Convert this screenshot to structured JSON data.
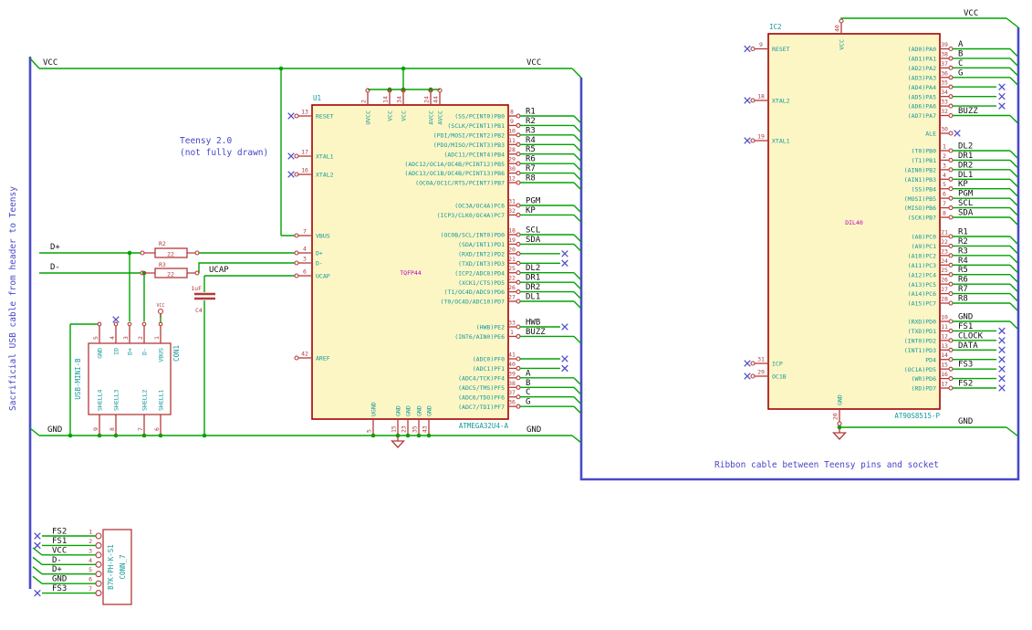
{
  "notes": {
    "sacrificial": "Sacrificial USB cable from header to Teensy",
    "teensy1": "Teensy 2.0",
    "teensy2": "(not fully drawn)",
    "ribbon": "Ribbon cable between Teensy pins and socket"
  },
  "labels": {
    "vcc": "VCC",
    "gnd": "GND",
    "dplus": "D+",
    "dminus": "D-",
    "ucap": "UCAP"
  },
  "u1": {
    "ref": "U1",
    "value": "ATMEGA32U4-A",
    "package": "TQFP44",
    "left_pins": [
      {
        "num": "13",
        "name": "RESET"
      },
      {
        "num": "17",
        "name": "XTAL1"
      },
      {
        "num": "16",
        "name": "XTAL2"
      },
      {
        "num": "7",
        "name": "VBUS"
      },
      {
        "num": "4",
        "name": "D+"
      },
      {
        "num": "3",
        "name": "D-"
      },
      {
        "num": "6",
        "name": "UCAP"
      },
      {
        "num": "42",
        "name": "AREF"
      }
    ],
    "top_pins": [
      {
        "num": "2",
        "name": "UVCC"
      },
      {
        "num": "14",
        "name": "VCC"
      },
      {
        "num": "34",
        "name": "VCC"
      },
      {
        "num": "24",
        "name": "AVCC"
      },
      {
        "num": "44",
        "name": "AVCC"
      }
    ],
    "bottom_pins": [
      {
        "num": "5",
        "name": "UGND"
      },
      {
        "num": "15",
        "name": "GND"
      },
      {
        "num": "23",
        "name": "GND"
      },
      {
        "num": "35",
        "name": "GND"
      },
      {
        "num": "43",
        "name": "GND"
      }
    ],
    "right_g1": [
      {
        "num": "8",
        "name": "(SS/PCINT0)PB0",
        "label": "R1",
        "term": "bus"
      },
      {
        "num": "9",
        "name": "(SCLK/PCINT1)PB1",
        "label": "R2",
        "term": "bus"
      },
      {
        "num": "10",
        "name": "(PDI/MOSI/PCINT2)PB2",
        "label": "R3",
        "term": "bus"
      },
      {
        "num": "11",
        "name": "(PDO/MISO/PCINT3)PB3",
        "label": "R4",
        "term": "bus"
      },
      {
        "num": "28",
        "name": "(ADC11/PCINT4)PB4",
        "label": "R5",
        "term": "bus"
      },
      {
        "num": "29",
        "name": "(ADC12/OC1A/OC4B/PCINT12)PB5",
        "label": "R6",
        "term": "bus"
      },
      {
        "num": "30",
        "name": "(ADC13/OC1B/OC4B/PCINT13)PB6",
        "label": "R7",
        "term": "bus"
      },
      {
        "num": "12",
        "name": "(OC0A/OC1C/RTS/PCINT7)PB7",
        "label": "R8",
        "term": "bus"
      }
    ],
    "right_g2": [
      {
        "num": "31",
        "name": "(OC3A/OC4A)PC6",
        "label": "PGM",
        "term": "bus"
      },
      {
        "num": "32",
        "name": "(ICP3/CLK0/OC4A)PC7",
        "label": "KP",
        "term": "bus"
      }
    ],
    "right_g3": [
      {
        "num": "18",
        "name": "(OC0B/SCL/INT0)PD0",
        "label": "SCL",
        "term": "bus"
      },
      {
        "num": "19",
        "name": "(SDA/INT1)PD1",
        "label": "SDA",
        "term": "bus"
      },
      {
        "num": "20",
        "name": "(RXD/INT2)PD2",
        "label": "",
        "term": "x"
      },
      {
        "num": "21",
        "name": "(TXD/INT3)PD3",
        "label": "",
        "term": "x"
      },
      {
        "num": "25",
        "name": "(ICP2/ADC8)PD4",
        "label": "DL2",
        "term": "bus"
      },
      {
        "num": "22",
        "name": "(XCK1/CTS)PD5",
        "label": "DR1",
        "term": "bus"
      },
      {
        "num": "26",
        "name": "(T1/OC4D/ADC9)PD6",
        "label": "DR2",
        "term": "bus"
      },
      {
        "num": "27",
        "name": "(T0/OC4D/ADC10)PD7",
        "label": "DL1",
        "term": "bus"
      }
    ],
    "right_g4": [
      {
        "num": "33",
        "name": "(HWB)PE2",
        "label": "HWB",
        "term": "x"
      },
      {
        "num": "1",
        "name": "(INT6/AIN0)PE6",
        "label": "BUZZ",
        "term": "bus"
      }
    ],
    "right_g5": [
      {
        "num": "41",
        "name": "(ADC0)PF0",
        "label": "",
        "term": "x"
      },
      {
        "num": "40",
        "name": "(ADC1)PF1",
        "label": "",
        "term": "x"
      },
      {
        "num": "39",
        "name": "(ADC4/TCK)PF4",
        "label": "A",
        "term": "bus"
      },
      {
        "num": "38",
        "name": "(ADC5/TMS)PF5",
        "label": "B",
        "term": "bus"
      },
      {
        "num": "37",
        "name": "(ADC6/TDO)PF6",
        "label": "C",
        "term": "bus"
      },
      {
        "num": "36",
        "name": "(ADC7/TDI)PF7",
        "label": "G",
        "term": "bus"
      }
    ]
  },
  "ic2": {
    "ref": "IC2",
    "value": "AT90S8515-P",
    "package": "DIL40",
    "left_pins": [
      {
        "num": "9",
        "name": "RESET"
      },
      {
        "num": "18",
        "name": "XTAL2"
      },
      {
        "num": "19",
        "name": "XTAL1"
      },
      {
        "num": "31",
        "name": "ICP"
      },
      {
        "num": "29",
        "name": "OC1B"
      }
    ],
    "top_pin": {
      "num": "40",
      "name": "VCC"
    },
    "bottom_pin": {
      "num": "20",
      "name": "GND"
    },
    "ale": {
      "num": "30",
      "name": "ALE"
    },
    "right_gA": [
      {
        "num": "39",
        "name": "(AD0)PA0",
        "label": "A",
        "term": "bus"
      },
      {
        "num": "38",
        "name": "(AD1)PA1",
        "label": "B",
        "term": "bus"
      },
      {
        "num": "37",
        "name": "(AD2)PA2",
        "label": "C",
        "term": "bus"
      },
      {
        "num": "36",
        "name": "(AD3)PA3",
        "label": "G",
        "term": "bus"
      },
      {
        "num": "35",
        "name": "(AD4)PA4",
        "label": "",
        "term": "x"
      },
      {
        "num": "34",
        "name": "(AD5)PA5",
        "label": "",
        "term": "x"
      },
      {
        "num": "33",
        "name": "(AD6)PA6",
        "label": "",
        "term": "x"
      },
      {
        "num": "32",
        "name": "(AD7)PA7",
        "label": "BUZZ",
        "term": "bus"
      }
    ],
    "right_gB": [
      {
        "num": "1",
        "name": "(T0)PB0",
        "label": "DL2",
        "term": "bus"
      },
      {
        "num": "2",
        "name": "(T1)PB1",
        "label": "DR1",
        "term": "bus"
      },
      {
        "num": "3",
        "name": "(AIN0)PB2",
        "label": "DR2",
        "term": "bus"
      },
      {
        "num": "4",
        "name": "(AIN1)PB3",
        "label": "DL1",
        "term": "bus"
      },
      {
        "num": "5",
        "name": "(SS)PB4",
        "label": "KP",
        "term": "bus"
      },
      {
        "num": "6",
        "name": "(MOSI)PB5",
        "label": "PGM",
        "term": "bus"
      },
      {
        "num": "7",
        "name": "(MISO)PB6",
        "label": "SCL",
        "term": "bus"
      },
      {
        "num": "8",
        "name": "(SCK)PB7",
        "label": "SDA",
        "term": "bus"
      }
    ],
    "right_gC": [
      {
        "num": "21",
        "name": "(A8)PC0",
        "label": "R1",
        "term": "bus"
      },
      {
        "num": "22",
        "name": "(A9)PC1",
        "label": "R2",
        "term": "bus"
      },
      {
        "num": "23",
        "name": "(A10)PC2",
        "label": "R3",
        "term": "bus"
      },
      {
        "num": "24",
        "name": "(A11)PC3",
        "label": "R4",
        "term": "bus"
      },
      {
        "num": "25",
        "name": "(A12)PC4",
        "label": "R5",
        "term": "bus"
      },
      {
        "num": "26",
        "name": "(A13)PC5",
        "label": "R6",
        "term": "bus"
      },
      {
        "num": "27",
        "name": "(A14)PC6",
        "label": "R7",
        "term": "bus"
      },
      {
        "num": "28",
        "name": "(A15)PC7",
        "label": "R8",
        "term": "bus"
      }
    ],
    "right_gD": [
      {
        "num": "10",
        "name": "(RXD)PD0",
        "label": "GND",
        "term": "bus"
      },
      {
        "num": "11",
        "name": "(TXD)PD1",
        "label": "FS1",
        "term": "x"
      },
      {
        "num": "12",
        "name": "(INT0)PD2",
        "label": "CLOCK",
        "term": "x"
      },
      {
        "num": "13",
        "name": "(INT1)PD3",
        "label": "DATA",
        "term": "x"
      },
      {
        "num": "14",
        "name": "PD4",
        "label": "",
        "term": "x"
      },
      {
        "num": "15",
        "name": "(OC1A)PD5",
        "label": "FS3",
        "term": "x"
      },
      {
        "num": "16",
        "name": "(WR)PD6",
        "label": "",
        "term": "x"
      },
      {
        "num": "17",
        "name": "(RD)PD7",
        "label": "FS2",
        "term": "x"
      }
    ]
  },
  "con1": {
    "ref": "CON1",
    "value": "USB-MINI-B",
    "power_flag": "VCC",
    "top_pins": [
      {
        "num": "5",
        "name": "GND"
      },
      {
        "num": "4",
        "name": "ID"
      },
      {
        "num": "3",
        "name": "D+"
      },
      {
        "num": "2",
        "name": "D-"
      },
      {
        "num": "1",
        "name": "VBUS"
      }
    ],
    "bottom_pins": [
      {
        "num": "9",
        "name": "SHELL4"
      },
      {
        "num": "8",
        "name": "SHELL3"
      },
      {
        "num": "7",
        "name": "SHELL2"
      },
      {
        "num": "6",
        "name": "SHELL1"
      }
    ]
  },
  "conn7": {
    "ref": "CONN_7",
    "value": "B7K-PH-K-S1",
    "rows": [
      {
        "num": "1",
        "label": "FS2",
        "term": "x"
      },
      {
        "num": "2",
        "label": "FS1",
        "term": "x"
      },
      {
        "num": "3",
        "label": "VCC",
        "term": "bus"
      },
      {
        "num": "4",
        "label": "D-",
        "term": "bus"
      },
      {
        "num": "5",
        "label": "D+",
        "term": "bus"
      },
      {
        "num": "6",
        "label": "GND",
        "term": "bus"
      },
      {
        "num": "7",
        "label": "FS3",
        "term": "x"
      }
    ]
  },
  "r2": {
    "ref": "R2",
    "value": "22"
  },
  "r3": {
    "ref": "R3",
    "value": "22"
  },
  "c4": {
    "ref": "C4",
    "value": "1uF"
  },
  "colors": {
    "wire": "#00A300",
    "bus": "#4A4AC8",
    "pin": "#B33A3A",
    "name": "#12999B",
    "field": "#BE00BE",
    "label": "#111111",
    "note": "#4646C8",
    "nc": "#5050CC",
    "chipfill": "#FCF6C5",
    "chipborder": "#A50000"
  }
}
